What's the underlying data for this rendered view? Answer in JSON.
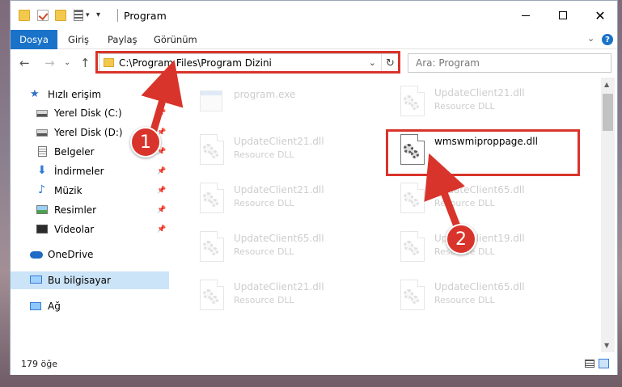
{
  "window": {
    "title": "Program"
  },
  "ribbon": {
    "file_tab": "Dosya",
    "tabs": [
      "Giriş",
      "Paylaş",
      "Görünüm"
    ],
    "help": "?"
  },
  "address": {
    "path": "C:\\Program Files\\Program Dizini"
  },
  "search": {
    "placeholder": "Ara: Program"
  },
  "sidebar": {
    "items": [
      {
        "label": "Hızlı erişim",
        "icon": "star-icon"
      },
      {
        "label": "Yerel Disk (C:)",
        "icon": "disk-icon"
      },
      {
        "label": "Yerel Disk (D:)",
        "icon": "disk-icon"
      },
      {
        "label": "Belgeler",
        "icon": "documents-icon"
      },
      {
        "label": "İndirmeler",
        "icon": "download-icon"
      },
      {
        "label": "Müzik",
        "icon": "music-icon"
      },
      {
        "label": "Resimler",
        "icon": "pictures-icon"
      },
      {
        "label": "Videolar",
        "icon": "videos-icon"
      },
      {
        "label": "OneDrive",
        "icon": "cloud-icon"
      },
      {
        "label": "Bu bilgisayar",
        "icon": "computer-icon"
      },
      {
        "label": "Ağ",
        "icon": "network-icon"
      }
    ]
  },
  "files": [
    {
      "name": "program.exe",
      "type": "",
      "ghost": true
    },
    {
      "name": "UpdateClient21.dll",
      "type": "Resource DLL",
      "ghost": true
    },
    {
      "name": "UpdateClient21.dll",
      "type": "Resource DLL",
      "ghost": true
    },
    {
      "name": "wmswmiproppage.dll",
      "type": "",
      "ghost": false
    },
    {
      "name": "UpdateClient21.dll",
      "type": "Resource DLL",
      "ghost": true
    },
    {
      "name": "UpdateClient65.dll",
      "type": "Resource DLL",
      "ghost": true
    },
    {
      "name": "UpdateClient65.dll",
      "type": "Resource DLL",
      "ghost": true
    },
    {
      "name": "UpdateClient19.dll",
      "type": "Resource DLL",
      "ghost": true
    },
    {
      "name": "UpdateClient21.dll",
      "type": "Resource DLL",
      "ghost": true
    },
    {
      "name": "UpdateClient65.dll",
      "type": "Resource DLL",
      "ghost": true
    }
  ],
  "status": {
    "item_count": "179 öğe"
  },
  "annotations": {
    "step1": "1",
    "step2": "2",
    "color": "#d9342b"
  }
}
